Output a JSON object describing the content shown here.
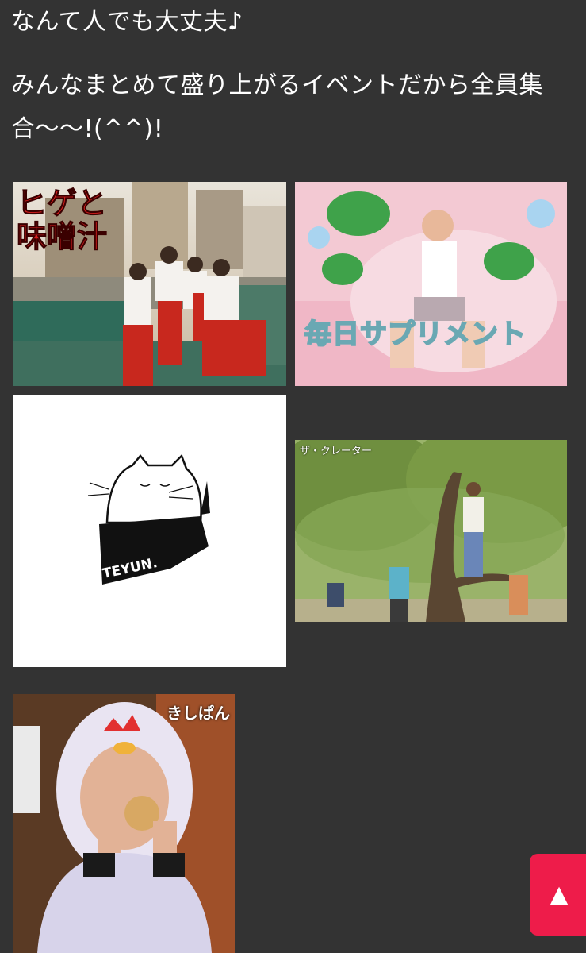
{
  "content": {
    "line1": "なんて人でも大丈夫♪",
    "paragraph": "みんなまとめて盛り上がるイベントだから全員集合〜〜!(^^)!"
  },
  "images": {
    "higemiso": {
      "overlay_text": "ヒゲと味噌汁"
    },
    "mainichi": {
      "overlay_text": "毎日サプリメント"
    },
    "teyun": {
      "overlay_text": "TEYUN."
    },
    "crater": {
      "caption": "ザ・クレーター"
    },
    "kishipan": {
      "caption": "きしぱん"
    }
  },
  "scroll_top": {
    "icon": "up-arrow-icon",
    "glyph": "▲",
    "color": "#ee1c4a"
  }
}
